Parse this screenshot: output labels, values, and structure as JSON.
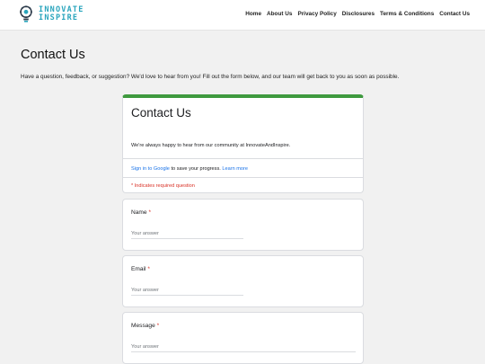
{
  "brand": {
    "line1": "INNOVATE",
    "line2": "INSPIRE"
  },
  "nav": [
    "Home",
    "About Us",
    "Privacy Policy",
    "Disclosures",
    "Terms & Conditions",
    "Contact Us"
  ],
  "page": {
    "title": "Contact Us",
    "intro": "Have a question, feedback, or suggestion? We'd love to hear from you! Fill out the form below, and our team will get back to you as soon as possible."
  },
  "form": {
    "title": "Contact Us",
    "description": "We're always happy to hear from our community at InnovateAndInspire.",
    "signin_link": "Sign in to Google",
    "signin_rest": " to save your progress. ",
    "learn_more": "Learn more",
    "required_note": "* Indicates required question",
    "questions": [
      {
        "label": "Name",
        "required_mark": "*",
        "placeholder": "Your answer"
      },
      {
        "label": "Email",
        "required_mark": "*",
        "placeholder": "Your answer"
      },
      {
        "label": "Message",
        "required_mark": "*",
        "placeholder": "Your answer"
      }
    ]
  },
  "colors": {
    "accent_green": "#3f9a3f",
    "link_blue": "#1a73e8",
    "required_red": "#d93025",
    "brand_teal": "#2aa5bd"
  },
  "icons": {
    "logo": "lightbulb-gear-icon"
  }
}
